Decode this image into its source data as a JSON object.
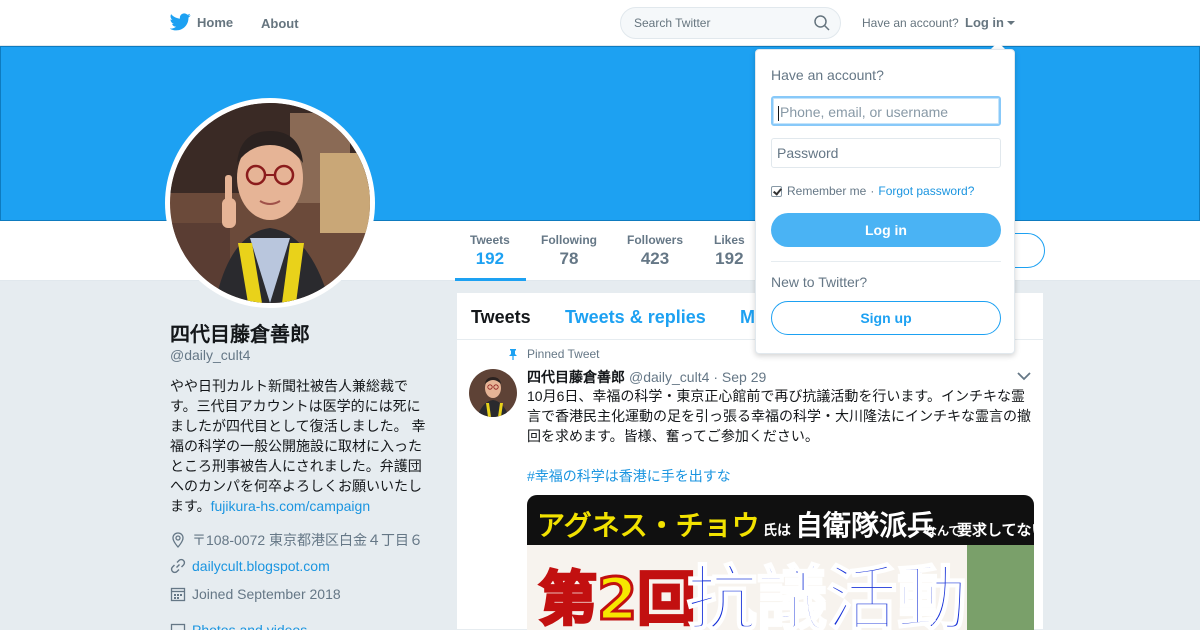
{
  "nav": {
    "home": "Home",
    "about": "About",
    "search_placeholder": "Search Twitter",
    "have_account": "Have an account?",
    "login": "Log in"
  },
  "profile": {
    "name": "四代目藤倉善郎",
    "handle": "@daily_cult4",
    "bio": "やや日刊カルト新聞社被告人兼総裁です。三代目アカウントは医学的には死にましたが四代目として復活しました。 幸福の科学の一般公開施設に取材に入ったところ刑事被告人にされました。弁護団へのカンパを何卒よろしくお願いいたします。",
    "bio_link": "fujikura-hs.com/campaign",
    "location": "〒108-0072 東京都港区白金４丁目６",
    "website": "dailycult.blogspot.com",
    "joined": "Joined September 2018",
    "photos": "Photos and videos"
  },
  "stats": [
    {
      "label": "Tweets",
      "value": "192"
    },
    {
      "label": "Following",
      "value": "78"
    },
    {
      "label": "Followers",
      "value": "423"
    },
    {
      "label": "Likes",
      "value": "192"
    }
  ],
  "timeline": {
    "tabs": [
      "Tweets",
      "Tweets & replies",
      "M"
    ],
    "pinned_label": "Pinned Tweet",
    "tweet": {
      "name": "四代目藤倉善郎",
      "handle": "@daily_cult4",
      "date": "· Sep 29",
      "text": "10月6日、幸福の科学・東京正心館前で再び抗議活動を行います。インチキな霊言で香港民主化運動の足を引っ張る幸福の科学・大川隆法にインチキな霊言の撤回を求めます。皆様、奮ってご参加ください。",
      "hashtag": "#幸福の科学は香港に手を出すな",
      "media_line1_a": "アグネス・チョウ",
      "media_line1_b": "氏は",
      "media_line1_c": "自衛隊派兵",
      "media_line1_d": "なんて",
      "media_line1_e": "要求してない!",
      "media_line2_a": "第2回",
      "media_line2_b": "抗議活動"
    }
  },
  "login_dropdown": {
    "title": "Have an account?",
    "username_placeholder": "Phone, email, or username",
    "password_placeholder": "Password",
    "remember": "Remember me",
    "forgot": "Forgot password?",
    "login_button": "Log in",
    "new_label": "New to Twitter?",
    "signup_button": "Sign up"
  },
  "colors": {
    "accent": "#1da1f2",
    "banner": "#1da1f2",
    "link": "#1b95e0"
  }
}
